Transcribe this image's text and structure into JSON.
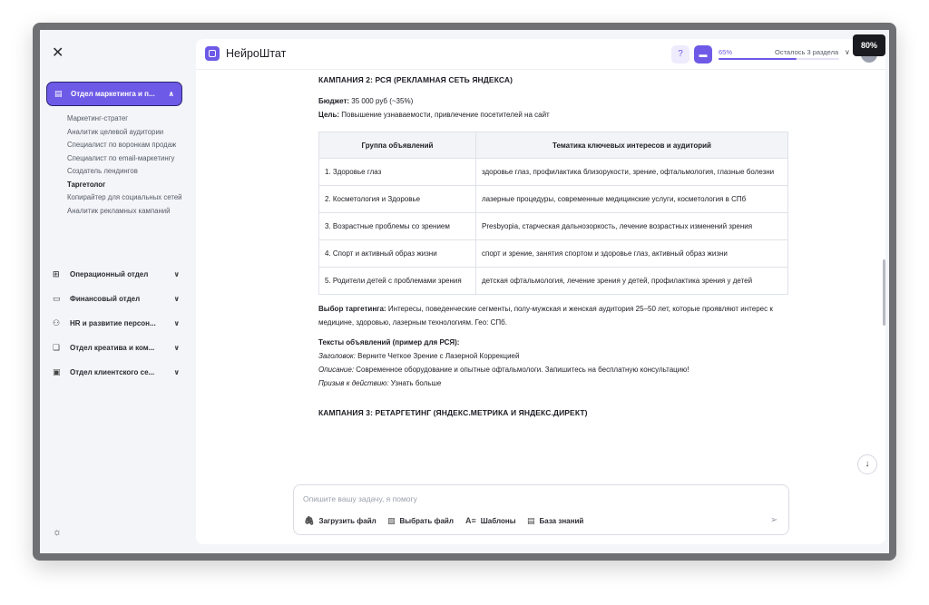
{
  "zoom": "80%",
  "brand": "НейроШтат",
  "progress": {
    "percent_label": "65%",
    "value": 0.65,
    "remaining": "Осталось 3 раздела"
  },
  "sidebar": {
    "active_dept": "Отдел маркетинга и п...",
    "sub_items": [
      {
        "label": "Маркетинг-стратег",
        "active": false
      },
      {
        "label": "Аналитик целевой аудитории",
        "active": false
      },
      {
        "label": "Специалист по воронкам продаж",
        "active": false
      },
      {
        "label": "Специалист по email-маркетингу",
        "active": false
      },
      {
        "label": "Создатель лендингов",
        "active": false
      },
      {
        "label": "Таргетолог",
        "active": true
      },
      {
        "label": "Копирайтер для социальных сетей",
        "active": false
      },
      {
        "label": "Аналитик рекламных кампаний",
        "active": false
      }
    ],
    "departments": [
      "Операционный отдел",
      "Финансовый отдел",
      "HR и развитие персон...",
      "Отдел креатива и ком...",
      "Отдел клиентского се..."
    ]
  },
  "content": {
    "campaign2_title": "КАМПАНИЯ 2: РСЯ (РЕКЛАМНАЯ СЕТЬ ЯНДЕКСА)",
    "budget_label": "Бюджет:",
    "budget_value": " 35 000 руб (~35%)",
    "goal_label": "Цель:",
    "goal_value": " Повышение узнаваемости, привлечение посетителей на сайт",
    "table": {
      "headers": [
        "Группа объявлений",
        "Тематика ключевых интересов и аудиторий"
      ],
      "rows": [
        [
          "1. Здоровье глаз",
          "здоровье глаз, профилактика близорукости, зрение, офтальмология, глазные болезни"
        ],
        [
          "2. Косметология и Здоровье",
          "лазерные процедуры, современные медицинские услуги, косметология в СПб"
        ],
        [
          "3. Возрастные проблемы со зрением",
          "Presbyopia, старческая дальнозоркость, лечение возрастных изменений зрения"
        ],
        [
          "4. Спорт и активный образ жизни",
          "спорт и зрение, занятия спортом и здоровье глаз, активный образ жизни"
        ],
        [
          "5. Родители детей с проблемами зрения",
          "детская офтальмология, лечение зрения у детей, профилактика зрения у детей"
        ]
      ]
    },
    "targeting_label": "Выбор таргетинга:",
    "targeting_value": " Интересы, поведенческие сегменты, полу-мужская и женская аудитория 25–50 лет, которые проявляют интерес к медицине, здоровью, лазерным технологиям. Гео: СПб.",
    "ad_texts_label": "Тексты объявлений (пример для РСЯ):",
    "headline_label": "Заголовок:",
    "headline_value": " Верните Четкое Зрение с Лазерной Коррекцией",
    "desc_label": "Описание:",
    "desc_value": " Современное оборудование и опытные офтальмологи. Запишитесь на бесплатную консультацию!",
    "cta_label": "Призыв к действию:",
    "cta_value": " Узнать больше",
    "campaign3_title": "КАМПАНИЯ 3: РЕТАРГЕТИНГ (ЯНДЕКС.МЕТРИКА И ЯНДЕКС.ДИРЕКТ)"
  },
  "composer": {
    "placeholder": "Опишите вашу задачу, я помогу",
    "upload": "Загрузить файл",
    "choose": "Выбрать файл",
    "templates": "Шаблоны",
    "knowledge": "База знаний"
  }
}
